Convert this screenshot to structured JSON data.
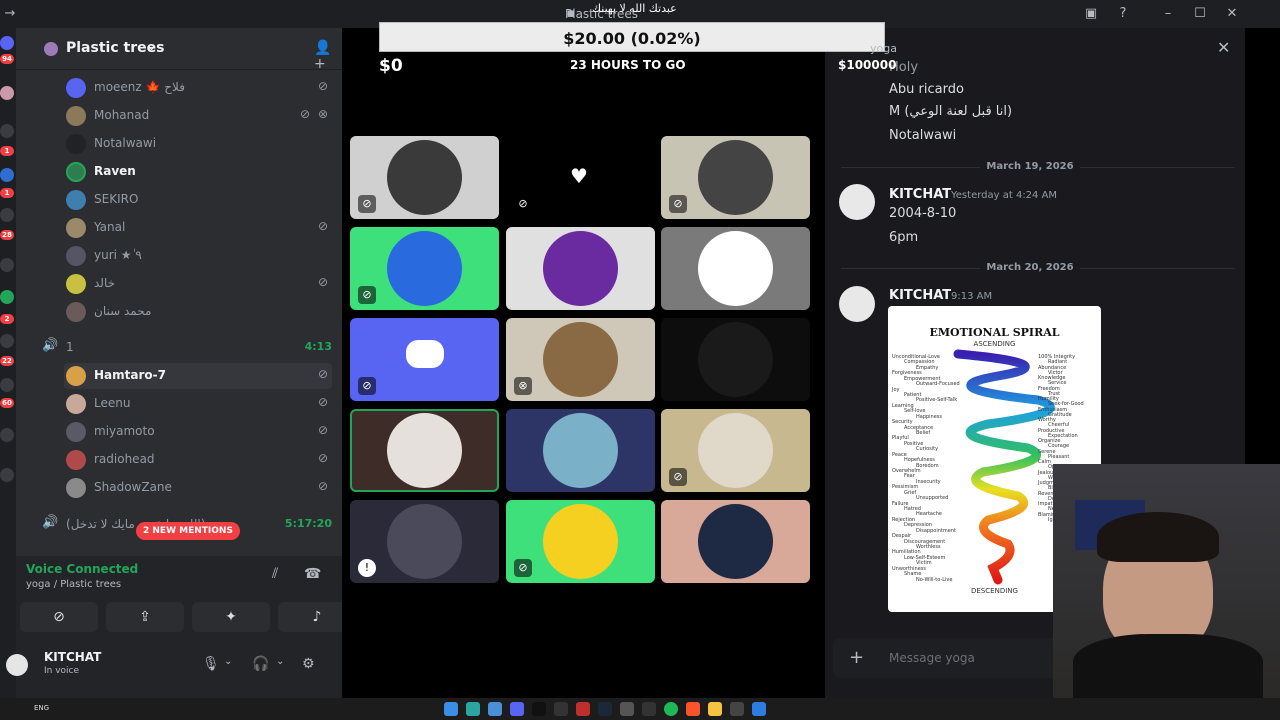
{
  "window": {
    "title": "Plastic trees"
  },
  "guild": {
    "name": "Plastic trees"
  },
  "members_top": [
    {
      "name": "moeenz 🍁 فلاح",
      "muted": true
    },
    {
      "name": "Mohanad",
      "muted": true,
      "deafened": true
    },
    {
      "name": "Notalwawi",
      "muted": false
    },
    {
      "name": "Raven",
      "muted": false,
      "bright": true
    },
    {
      "name": "SEKIRO",
      "muted": false
    },
    {
      "name": "Yanal",
      "muted": true
    },
    {
      "name": "yuri ★ٰ ٩",
      "muted": false
    },
    {
      "name": "خالد",
      "muted": true
    },
    {
      "name": "محمد سنان",
      "muted": false
    }
  ],
  "voice_channel_1": {
    "name": "1",
    "timer": "4:13"
  },
  "members_channel_1": [
    {
      "name": "Hamtaro-7",
      "muted": true,
      "bright": true
    },
    {
      "name": "Leenu",
      "muted": true
    },
    {
      "name": "miyamoto",
      "muted": true
    },
    {
      "name": "radiohead",
      "muted": true
    },
    {
      "name": "ShadowZane",
      "muted": true
    }
  ],
  "voice_channel_2": {
    "name": "(اللي ما عنده مايك لا تدخل)",
    "timer": "5:17:20"
  },
  "mentions": {
    "label": "2 NEW MENTIONS"
  },
  "voice_panel": {
    "status": "Voice Connected",
    "location": "yoga / Plastic trees"
  },
  "user": {
    "name": "KITCHAT",
    "status": "In voice"
  },
  "overlay": {
    "amount": "$20.00 (0.02%)",
    "raised": "$0",
    "countdown": "23 HOURS TO GO",
    "goal": "$100000",
    "header_text": "عبدتك الله لا يهينك"
  },
  "rail_badges": [
    "94",
    "1",
    "1",
    "28",
    "2",
    "22",
    "60"
  ],
  "chat": {
    "channel_hint": "yoga",
    "prev_lines": [
      "Holy",
      "Abu ricardo",
      "M (انا قبل لعنة الوعي)",
      "Notalwawi"
    ],
    "dividers": [
      "March 19, 2026",
      "March 20, 2026"
    ],
    "messages": [
      {
        "author": "KITCHAT",
        "time": "Yesterday at 4:24 AM",
        "lines": [
          "2004-8-10",
          "6pm"
        ]
      },
      {
        "author": "KITCHAT",
        "time": "9:13 AM",
        "lines": []
      }
    ],
    "composer_placeholder": "Message yoga"
  },
  "spiral_image": {
    "title": "EMOTIONAL SPIRAL",
    "ascending": "ASCENDING",
    "descending": "DESCENDING",
    "left_words": [
      "Unconditional-Love",
      "Compassion",
      "Empathy",
      "Forgiveness",
      "Empowerment",
      "Outward-Focused",
      "Joy",
      "Patient",
      "Positive-Self-Talk",
      "Learning",
      "Self-love",
      "Happiness",
      "Security",
      "Acceptance",
      "Belief",
      "Playful",
      "Positive",
      "Curiosity",
      "Peace",
      "Hopefulness",
      "Boredom",
      "Overwhelm",
      "Fear",
      "Insecurity",
      "Pessimism",
      "Grief",
      "Unsupported",
      "Failure",
      "Hatred",
      "Heartache",
      "Rejection",
      "Depression",
      "Disappointment",
      "Despair",
      "Discouragement",
      "Worthless",
      "Humiliation",
      "Low-Self-Esteem",
      "Victim",
      "Unworthiness",
      "Shame",
      "No-Will-to-Live"
    ],
    "right_words": [
      "100% Integrity",
      "Radiant",
      "Abundance",
      "Victor",
      "Knowledge",
      "Service",
      "Freedom",
      "Trust",
      "Humility",
      "Seek-for-Good",
      "Enthusiasm",
      "Gratitude",
      "Worthy",
      "Cheerful",
      "Productive",
      "Expectation",
      "Organize",
      "Courage",
      "Serene",
      "Pleasant",
      "Calm",
      "Optimism",
      "Jealousy",
      "Worry",
      "Judgment",
      "Blame",
      "Revenge",
      "Doubt",
      "Impatient",
      "Negative",
      "Blaming",
      "Ignorance"
    ]
  }
}
